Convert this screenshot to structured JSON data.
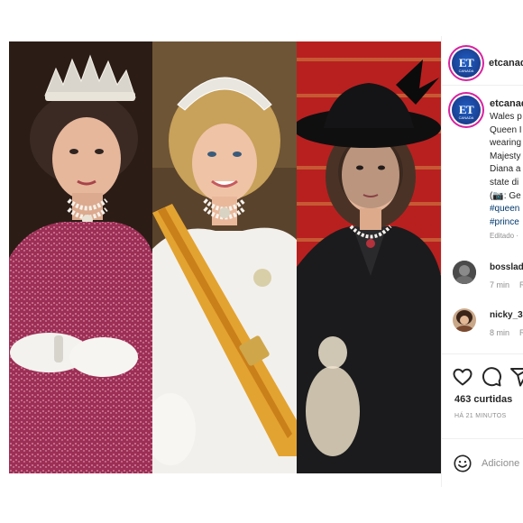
{
  "post": {
    "account": {
      "username": "etcanad",
      "avatar_text": "ET",
      "avatar_subtext": "CANADA"
    },
    "caption_lines": [
      "Wales p",
      "Queen I",
      "wearing",
      "Majesty",
      "Diana a",
      "state di",
      "(📷: Ge"
    ],
    "hashtags": [
      "#queen",
      "#prince"
    ],
    "edited_label": "Editado ·",
    "comments": [
      {
        "username": "bosslad",
        "time": "7 min",
        "reply": "R"
      },
      {
        "username": "nicky_3",
        "time": "8 min",
        "reply": "R"
      }
    ],
    "actions": {
      "like_icon": "heart-icon",
      "comment_icon": "comment-icon",
      "share_icon": "paper-plane-icon"
    },
    "likes_label": "463 curtidas",
    "time_ago": "HÁ 21 MINUTOS",
    "comment_box": {
      "emoji_icon": "smiley-icon",
      "placeholder": "Adicione"
    }
  },
  "colors": {
    "text": "#262626",
    "muted": "#8e8e8e",
    "hashtag": "#00376b",
    "story_ring": "#d6249f",
    "et_blue": "#1a3f8f"
  }
}
